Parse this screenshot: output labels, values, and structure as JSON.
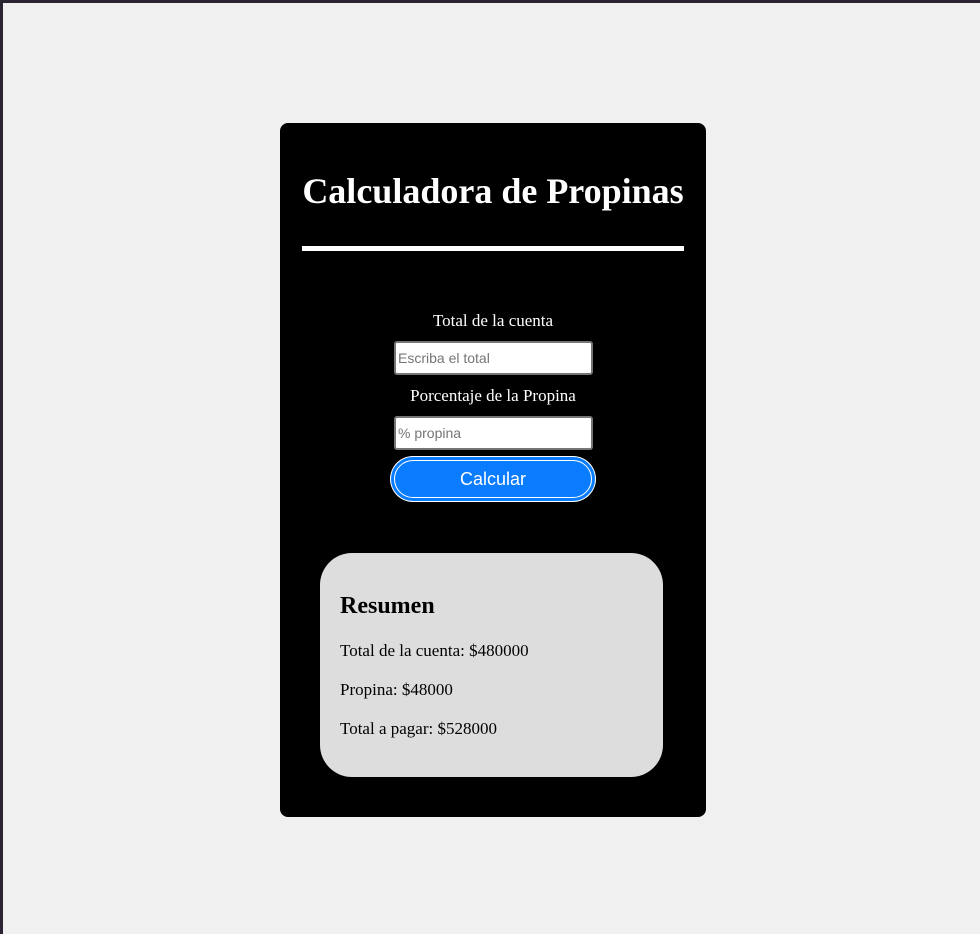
{
  "app": {
    "title": "Calculadora de Propinas"
  },
  "form": {
    "total_label": "Total de la cuenta",
    "total_placeholder": "Escriba el total",
    "total_value": "",
    "percent_label": "Porcentaje de la Propina",
    "percent_placeholder": "% propina",
    "percent_value": "",
    "submit_label": "Calcular"
  },
  "summary": {
    "title": "Resumen",
    "total_line": "Total de la cuenta: $480000",
    "tip_line": "Propina: $48000",
    "grand_total_line": "Total a pagar: $528000"
  },
  "colors": {
    "card_background": "#000000",
    "button_accent": "#0a7cff",
    "summary_background": "#dddddd",
    "page_background": "#f0f0f0"
  }
}
